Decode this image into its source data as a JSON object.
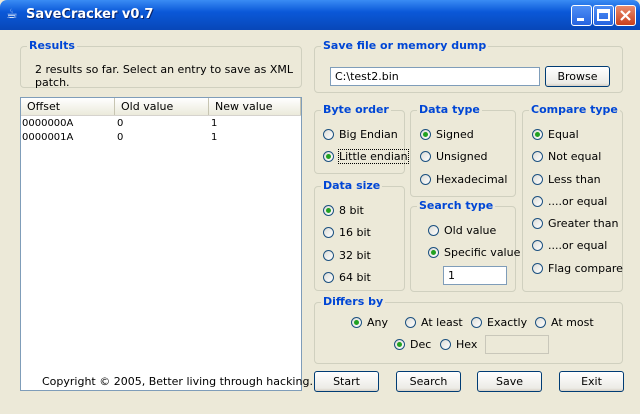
{
  "window": {
    "title": "SaveCracker v0.7"
  },
  "results": {
    "label": "Results",
    "status": "2 results so far. Select an entry to save as XML patch.",
    "columns": [
      "Offset",
      "Old  value",
      "New value"
    ],
    "rows": [
      {
        "offset": "0000000A",
        "old": "0",
        "new": "1"
      },
      {
        "offset": "0000001A",
        "old": "0",
        "new": "1"
      }
    ]
  },
  "save_file": {
    "label": "Save file or memory dump",
    "path": "C:\\test2.bin",
    "browse": "Browse"
  },
  "byte_order": {
    "label": "Byte order",
    "options": [
      "Big Endian",
      "Little endian"
    ],
    "selected": "Little endian"
  },
  "data_type": {
    "label": "Data type",
    "options": [
      "Signed",
      "Unsigned",
      "Hexadecimal"
    ],
    "selected": "Signed"
  },
  "compare_type": {
    "label": "Compare type",
    "options": [
      "Equal",
      "Not equal",
      "Less than",
      "....or equal",
      "Greater than",
      "....or equal",
      "Flag compare"
    ],
    "selected": "Equal"
  },
  "data_size": {
    "label": "Data size",
    "options": [
      "8 bit",
      "16 bit",
      "32 bit",
      "64 bit"
    ],
    "selected": "8 bit"
  },
  "search_type": {
    "label": "Search type",
    "options": [
      "Old value",
      "Specific value"
    ],
    "selected": "Specific value",
    "value": "1"
  },
  "differs_by": {
    "label": "Differs by",
    "options": [
      "Any",
      "At least",
      "Exactly",
      "At most"
    ],
    "selected": "Any",
    "base_options": [
      "Dec",
      "Hex"
    ],
    "base_selected": "Dec",
    "amount": ""
  },
  "buttons": {
    "start": "Start",
    "search": "Search",
    "save": "Save",
    "exit": "Exit"
  },
  "copyright": "Copyright © 2005, Better living through hacking."
}
